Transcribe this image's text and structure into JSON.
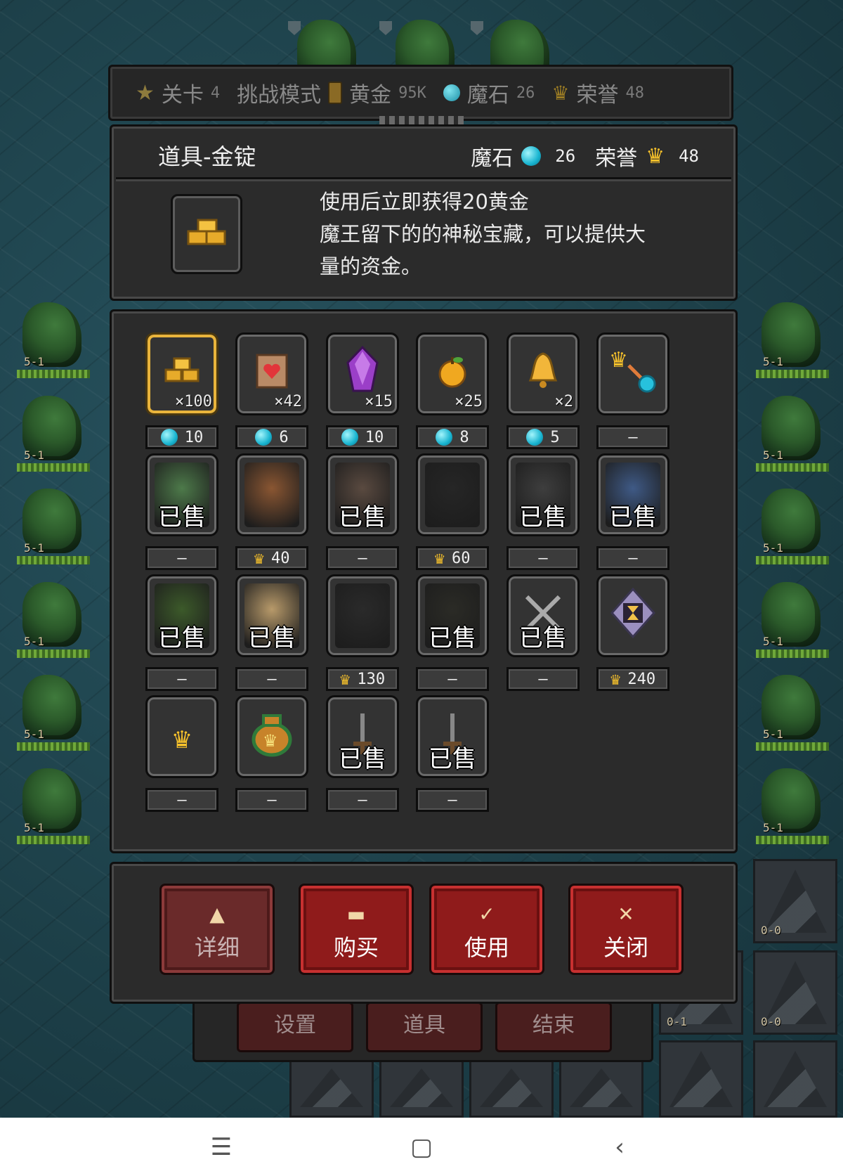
{
  "status_bar": {
    "level_label": "关卡",
    "level_value": "4",
    "mode_label": "挑战模式",
    "gold_label": "黄金",
    "gold_value": "95K",
    "magic_stone_label": "魔石",
    "magic_stone_value": "26",
    "honor_label": "荣誉",
    "honor_value": "48"
  },
  "info_panel": {
    "title": "道具-金锭",
    "magic_stone_label": "魔石",
    "magic_stone_value": "26",
    "honor_label": "荣誉",
    "honor_value": "48",
    "desc_line1": "使用后立即获得20黄金",
    "desc_line2": "魔王留下的的神秘宝藏，可以提供大",
    "desc_line3": "量的资金。"
  },
  "sold_label": "已售",
  "dash": "—",
  "items": [
    {
      "name": "gold-ingot",
      "icon": "gold-ingot-icon",
      "qty": "×100",
      "price": "10",
      "currency": "gem",
      "selected": true
    },
    {
      "name": "scroll",
      "icon": "heart-scroll-icon",
      "qty": "×42",
      "price": "6",
      "currency": "gem"
    },
    {
      "name": "crystal",
      "icon": "purple-crystal-icon",
      "qty": "×15",
      "price": "10",
      "currency": "gem"
    },
    {
      "name": "apple",
      "icon": "golden-apple-icon",
      "qty": "×25",
      "price": "8",
      "currency": "gem"
    },
    {
      "name": "bell",
      "icon": "bell-icon",
      "qty": "×2",
      "price": "5",
      "currency": "gem"
    },
    {
      "name": "exchange",
      "icon": "crown-to-gem-icon",
      "qty": "",
      "price": "—",
      "currency": "none"
    },
    {
      "name": "slime",
      "icon": "green-slime-portrait",
      "sold": true,
      "price": "—",
      "currency": "none"
    },
    {
      "name": "treant",
      "icon": "treant-portrait",
      "sold": false,
      "price": "40",
      "currency": "crown"
    },
    {
      "name": "knight",
      "icon": "armored-knight-portrait",
      "sold": true,
      "price": "—",
      "currency": "none"
    },
    {
      "name": "reaper",
      "icon": "dark-reaper-portrait",
      "sold": false,
      "price": "60",
      "currency": "crown"
    },
    {
      "name": "witch",
      "icon": "witch-portrait",
      "sold": true,
      "price": "—",
      "currency": "none"
    },
    {
      "name": "mage-girl",
      "icon": "blue-mage-portrait",
      "sold": true,
      "price": "—",
      "currency": "none"
    },
    {
      "name": "forest-spirit",
      "icon": "forest-spirit-portrait",
      "sold": true,
      "price": "—",
      "currency": "none"
    },
    {
      "name": "vampire-girl",
      "icon": "vampire-girl-portrait",
      "sold": true,
      "price": "—",
      "currency": "none"
    },
    {
      "name": "hooded-demon",
      "icon": "hooded-demon-portrait",
      "sold": false,
      "price": "130",
      "currency": "crown"
    },
    {
      "name": "dark-wizard",
      "icon": "dark-wizard-portrait",
      "sold": true,
      "price": "—",
      "currency": "none"
    },
    {
      "name": "swords",
      "icon": "crossed-swords-icon",
      "sold": true,
      "price": "—",
      "currency": "none"
    },
    {
      "name": "hourglass",
      "icon": "hourglass-icon",
      "sold": false,
      "price": "240",
      "currency": "crown"
    },
    {
      "name": "crown",
      "icon": "crown-icon",
      "sold": false,
      "price": "—",
      "currency": "none"
    },
    {
      "name": "bag",
      "icon": "crown-bag-icon",
      "sold": false,
      "price": "—",
      "currency": "none"
    },
    {
      "name": "sword-a",
      "icon": "sword-icon",
      "sold": true,
      "price": "—",
      "currency": "none"
    },
    {
      "name": "sword-b",
      "icon": "sword-icon",
      "sold": true,
      "price": "—",
      "currency": "none"
    }
  ],
  "buttons": {
    "detail": "详细",
    "buy": "购买",
    "use": "使用",
    "close": "关闭"
  },
  "under_menu": {
    "settings": "设置",
    "items": "道具",
    "end": "结束"
  },
  "map_tags": {
    "dragon": "5-1",
    "tower_a": "0-0",
    "tower_b": "0-1"
  },
  "colors": {
    "accent_gold": "#f6c12b",
    "gem_cyan": "#18b4d0",
    "button_red": "#8f1b1b",
    "panel_bg": "#2b2b2b"
  }
}
